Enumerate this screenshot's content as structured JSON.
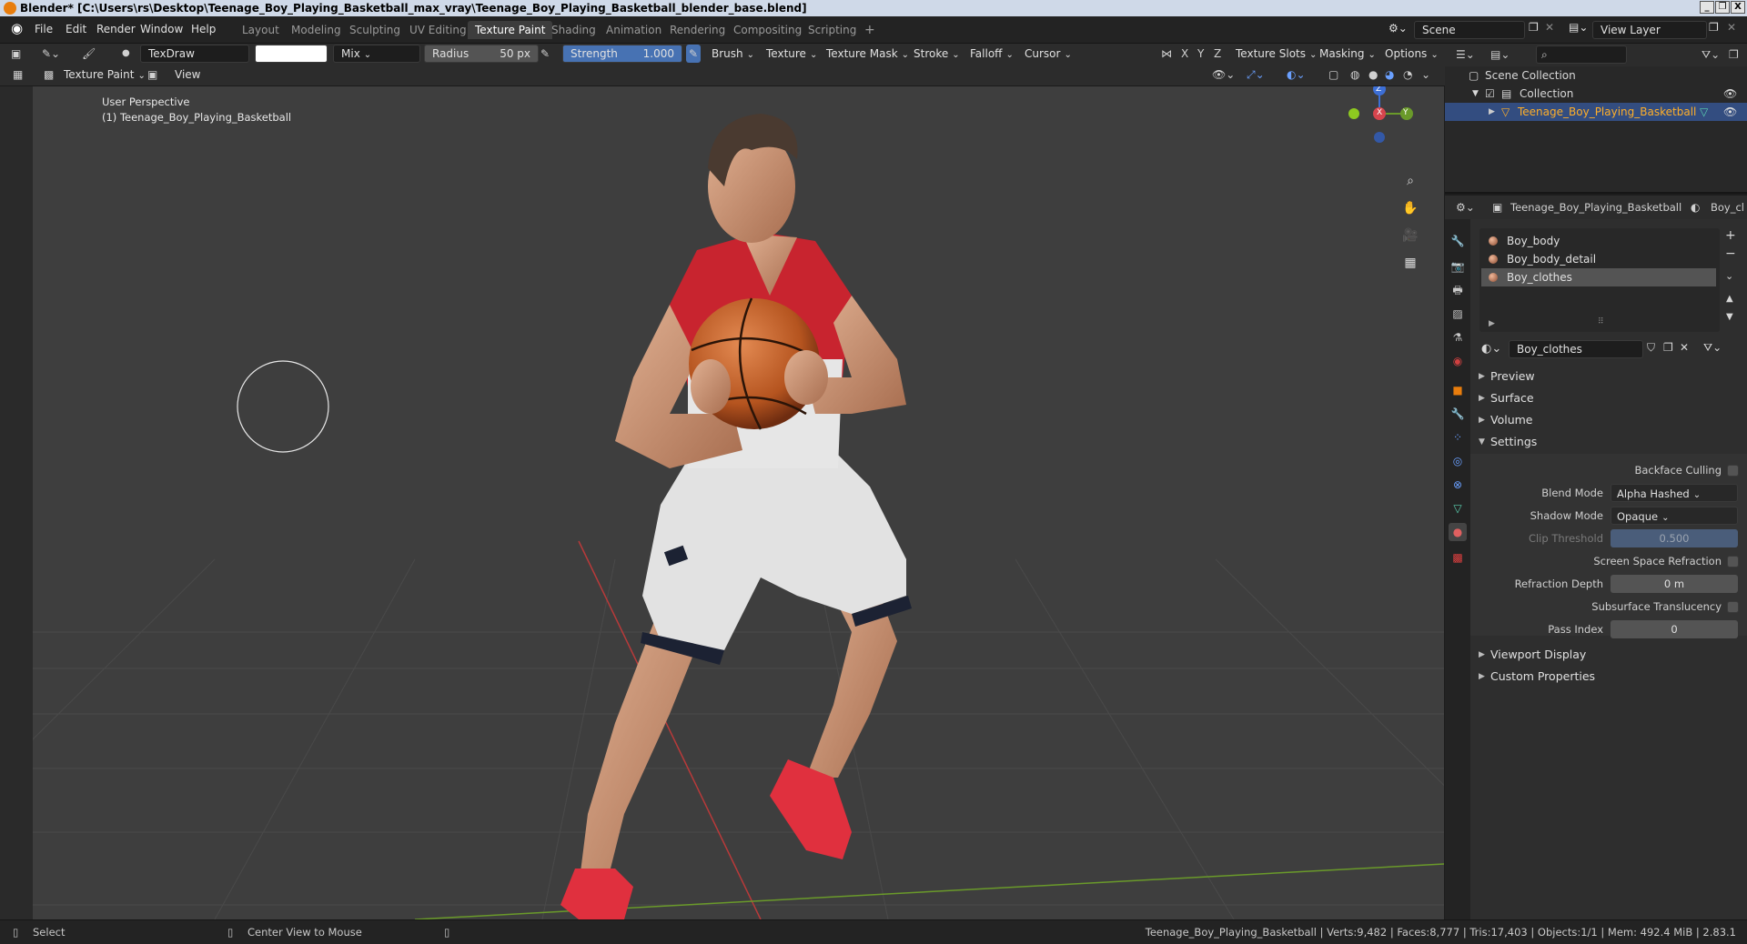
{
  "window": {
    "title": "Blender* [C:\\Users\\rs\\Desktop\\Teenage_Boy_Playing_Basketball_max_vray\\Teenage_Boy_Playing_Basketball_blender_base.blend]",
    "minimize": "_",
    "maximize": "❐",
    "close": "X"
  },
  "menu": [
    "File",
    "Edit",
    "Render",
    "Window",
    "Help"
  ],
  "workspaces": [
    "Layout",
    "Modeling",
    "Sculpting",
    "UV Editing",
    "Texture Paint",
    "Shading",
    "Animation",
    "Rendering",
    "Compositing",
    "Scripting"
  ],
  "active_workspace": "Texture Paint",
  "add_workspace": "+",
  "scene": {
    "name": "Scene",
    "view_layer": "View Layer"
  },
  "tool_header": {
    "brush_name": "TexDraw",
    "blend": "Mix",
    "radius_label": "Radius",
    "radius_value": "50 px",
    "strength_label": "Strength",
    "strength_value": "1.000",
    "strength_fraction": 1.0,
    "menus": [
      "Brush",
      "Texture",
      "Texture Mask",
      "Stroke",
      "Falloff",
      "Cursor"
    ],
    "axes": [
      "X",
      "Y",
      "Z"
    ],
    "right_menus": [
      "Texture Slots",
      "Masking",
      "Options"
    ]
  },
  "editor_header": {
    "mode": "Texture Paint",
    "view": "View"
  },
  "viewport": {
    "perspective": "User Perspective",
    "object_label": "(1) Teenage_Boy_Playing_Basketball",
    "gizmo_axes": {
      "z": "Z",
      "y": "Y",
      "x": "X"
    }
  },
  "outliner": {
    "scene_collection": "Scene Collection",
    "collection": "Collection",
    "object": "Teenage_Boy_Playing_Basketball"
  },
  "properties": {
    "object_name": "Teenage_Boy_Playing_Basketball",
    "material_short": "Boy_cl",
    "material_slots": [
      "Boy_body",
      "Boy_body_detail",
      "Boy_clothes"
    ],
    "selected_slot": "Boy_clothes",
    "material_name": "Boy_clothes",
    "panels": {
      "preview": "Preview",
      "surface": "Surface",
      "volume": "Volume",
      "settings": "Settings",
      "viewport_display": "Viewport Display",
      "custom_properties": "Custom Properties"
    },
    "settings": {
      "backface_culling": "Backface Culling",
      "blend_mode_label": "Blend Mode",
      "blend_mode": "Alpha Hashed",
      "shadow_mode_label": "Shadow Mode",
      "shadow_mode": "Opaque",
      "clip_threshold_label": "Clip Threshold",
      "clip_threshold": "0.500",
      "screen_space_refraction": "Screen Space Refraction",
      "refraction_depth_label": "Refraction Depth",
      "refraction_depth": "0 m",
      "subsurface_translucency": "Subsurface Translucency",
      "pass_index_label": "Pass Index",
      "pass_index": "0"
    }
  },
  "statusbar": {
    "select": "Select",
    "center_view": "Center View to Mouse",
    "stats": "Teenage_Boy_Playing_Basketball | Verts:9,482 | Faces:8,777 | Tris:17,403 | Objects:1/1 | Mem: 492.4 MiB | 2.83.1"
  },
  "colors": {
    "accent": "#4772b3",
    "selected_text": "#ffaf29",
    "viewport_bg": "#3e3e3e",
    "jersey_red": "#c8242f",
    "shoe_red": "#e0303e"
  }
}
